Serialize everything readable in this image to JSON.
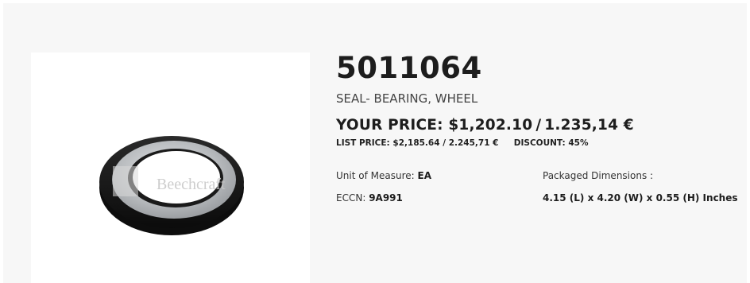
{
  "product": {
    "part_number": "5011064",
    "description": "SEAL- BEARING, WHEEL",
    "image_alt_watermark": "Beechcraft",
    "pricing": {
      "your_price_label": "YOUR PRICE:",
      "your_price_usd": "$1,202.10",
      "separator": "/",
      "your_price_eur": "1.235,14 €",
      "list_price_label": "LIST PRICE:",
      "list_price_usd": "$2,185.64",
      "list_price_eur": "2.245,71 €",
      "discount_label": "DISCOUNT:",
      "discount_value": "45%"
    },
    "specs": {
      "uom_label": "Unit of Measure:",
      "uom_value": "EA",
      "eccn_label": "ECCN:",
      "eccn_value": "9A991",
      "dimensions_label": "Packaged Dimensions :",
      "dimensions_value": "4.15 (L) x 4.20 (W) x 0.55 (H) Inches"
    }
  },
  "colors": {
    "background": "#f7f7f7",
    "image_background": "#ffffff",
    "seal_black": "#151515",
    "seal_metal": "#b9bcbf"
  }
}
